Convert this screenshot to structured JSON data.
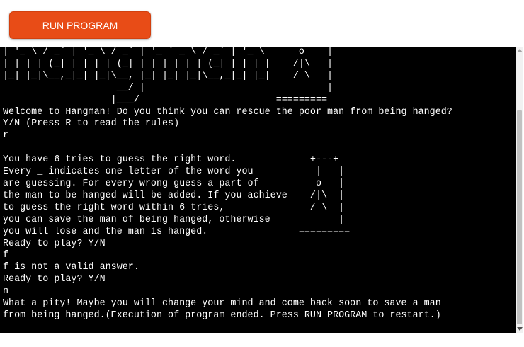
{
  "toolbar": {
    "run_label": "RUN PROGRAM"
  },
  "terminal": {
    "text": "| '_ \\ / _` | '_ \\ / _` | '_ ` _ \\ / _` | '_ \\      o    |\n| | | | (_| | | | | (_| | | | | | | (_| | | | |    /|\\   |\n|_| |_|\\__,_|_| |_|\\__, |_| |_| |_|\\__,_|_| |_|    / \\   |\n                    __/ |                                |\n                   |___/                        =========\nWelcome to Hangman! Do you think you can rescue the poor man from being hanged?\nY/N (Press R to read the rules)\nr\n\nYou have 6 tries to guess the right word.             +---+\nEvery _ indicates one letter of the word you           |   |\nare guessing. For every wrong guess a part of          o   |\nthe man to be hanged will be added. If you achieve    /|\\  |\nto guess the right word within 6 tries,               / \\  |\nyou can save the man of being hanged, otherwise            |\nyou will lose and the man is hanged.                =========\nReady to play? Y/N\nf\nf is not a valid answer.\nReady to play? Y/N\nn\nWhat a pity! Maybe you will change your mind and come back soon to save a man\nfrom being hanged.(Execution of program ended. Press RUN PROGRAM to restart.)"
  },
  "colors": {
    "accent": "#e84c17",
    "terminal_background": "#000000",
    "terminal_text": "#ffffff"
  },
  "icons": {
    "scroll_up": "triangle-up-icon",
    "scroll_down": "triangle-down-icon"
  }
}
